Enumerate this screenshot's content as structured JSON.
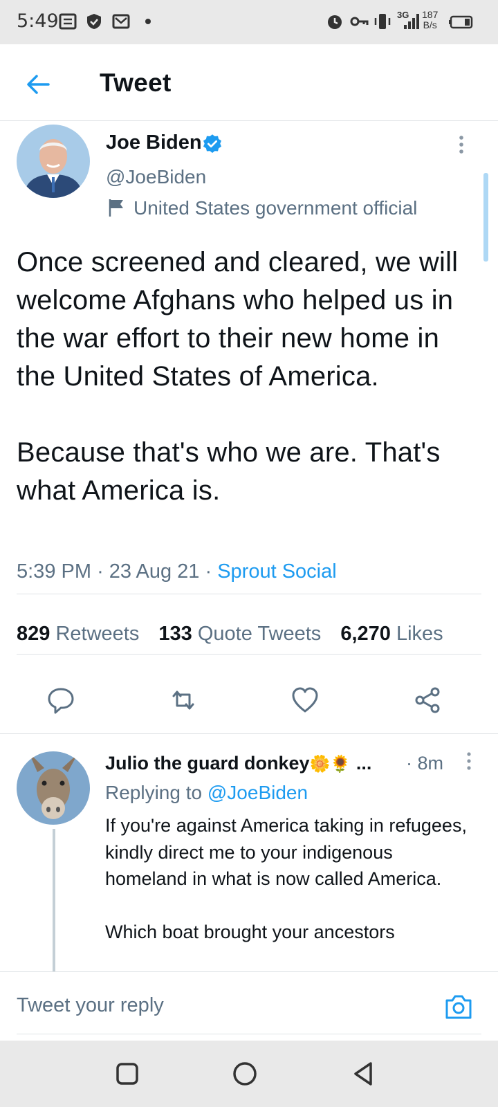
{
  "status_bar": {
    "time": "5:49",
    "network_label": "3G",
    "speed_value": "187",
    "speed_unit": "B/s"
  },
  "header": {
    "title": "Tweet"
  },
  "tweet": {
    "author_name": "Joe Biden",
    "handle": "@JoeBiden",
    "label": "United States government official",
    "text": "Once screened and cleared, we will welcome Afghans who helped us in the war effort to their new home in the United States of America.\n\nBecause that's who we are. That's what America is.",
    "time": "5:39 PM",
    "date": "23 Aug 21",
    "source": "Sprout Social",
    "retweets_count": "829",
    "retweets_label": "Retweets",
    "quote_count": "133",
    "quote_label": "Quote Tweets",
    "likes_count": "6,270",
    "likes_label": "Likes"
  },
  "reply": {
    "author_name": "Julio the guard donkey",
    "author_emoji": "🌼🌻",
    "ellipsis": "...",
    "age": "· 8m",
    "replying_label": "Replying to",
    "replying_handle": "@JoeBiden",
    "text": "If you're against America taking in refugees, kindly direct me to your indigenous homeland in what is now called America.\n\nWhich boat brought your ancestors"
  },
  "compose": {
    "placeholder": "Tweet your reply"
  },
  "colors": {
    "accent": "#1d9bf0",
    "muted": "#5b7083",
    "divider": "#dfe3e6"
  }
}
